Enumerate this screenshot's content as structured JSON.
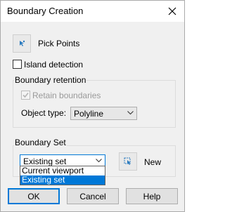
{
  "window": {
    "title": "Boundary Creation",
    "close_icon": "close-icon"
  },
  "pick_points": {
    "label": "Pick Points",
    "icon": "pick-points-icon"
  },
  "island_detection": {
    "label": "Island detection",
    "checked": false
  },
  "boundary_retention": {
    "group_label": "Boundary retention",
    "retain": {
      "label": "Retain boundaries",
      "checked": true,
      "disabled": true
    },
    "object_type": {
      "label": "Object type:",
      "value": "Polyline"
    }
  },
  "boundary_set": {
    "group_label": "Boundary Set",
    "combo_value": "Existing set",
    "options": [
      "Current viewport",
      "Existing set"
    ],
    "selected_option": "Existing set",
    "new_label": "New",
    "new_icon": "new-selection-icon"
  },
  "buttons": {
    "ok": "OK",
    "cancel": "Cancel",
    "help": "Help"
  },
  "colors": {
    "accent": "#0078d7",
    "dialog_bg": "#f0f0f0"
  }
}
